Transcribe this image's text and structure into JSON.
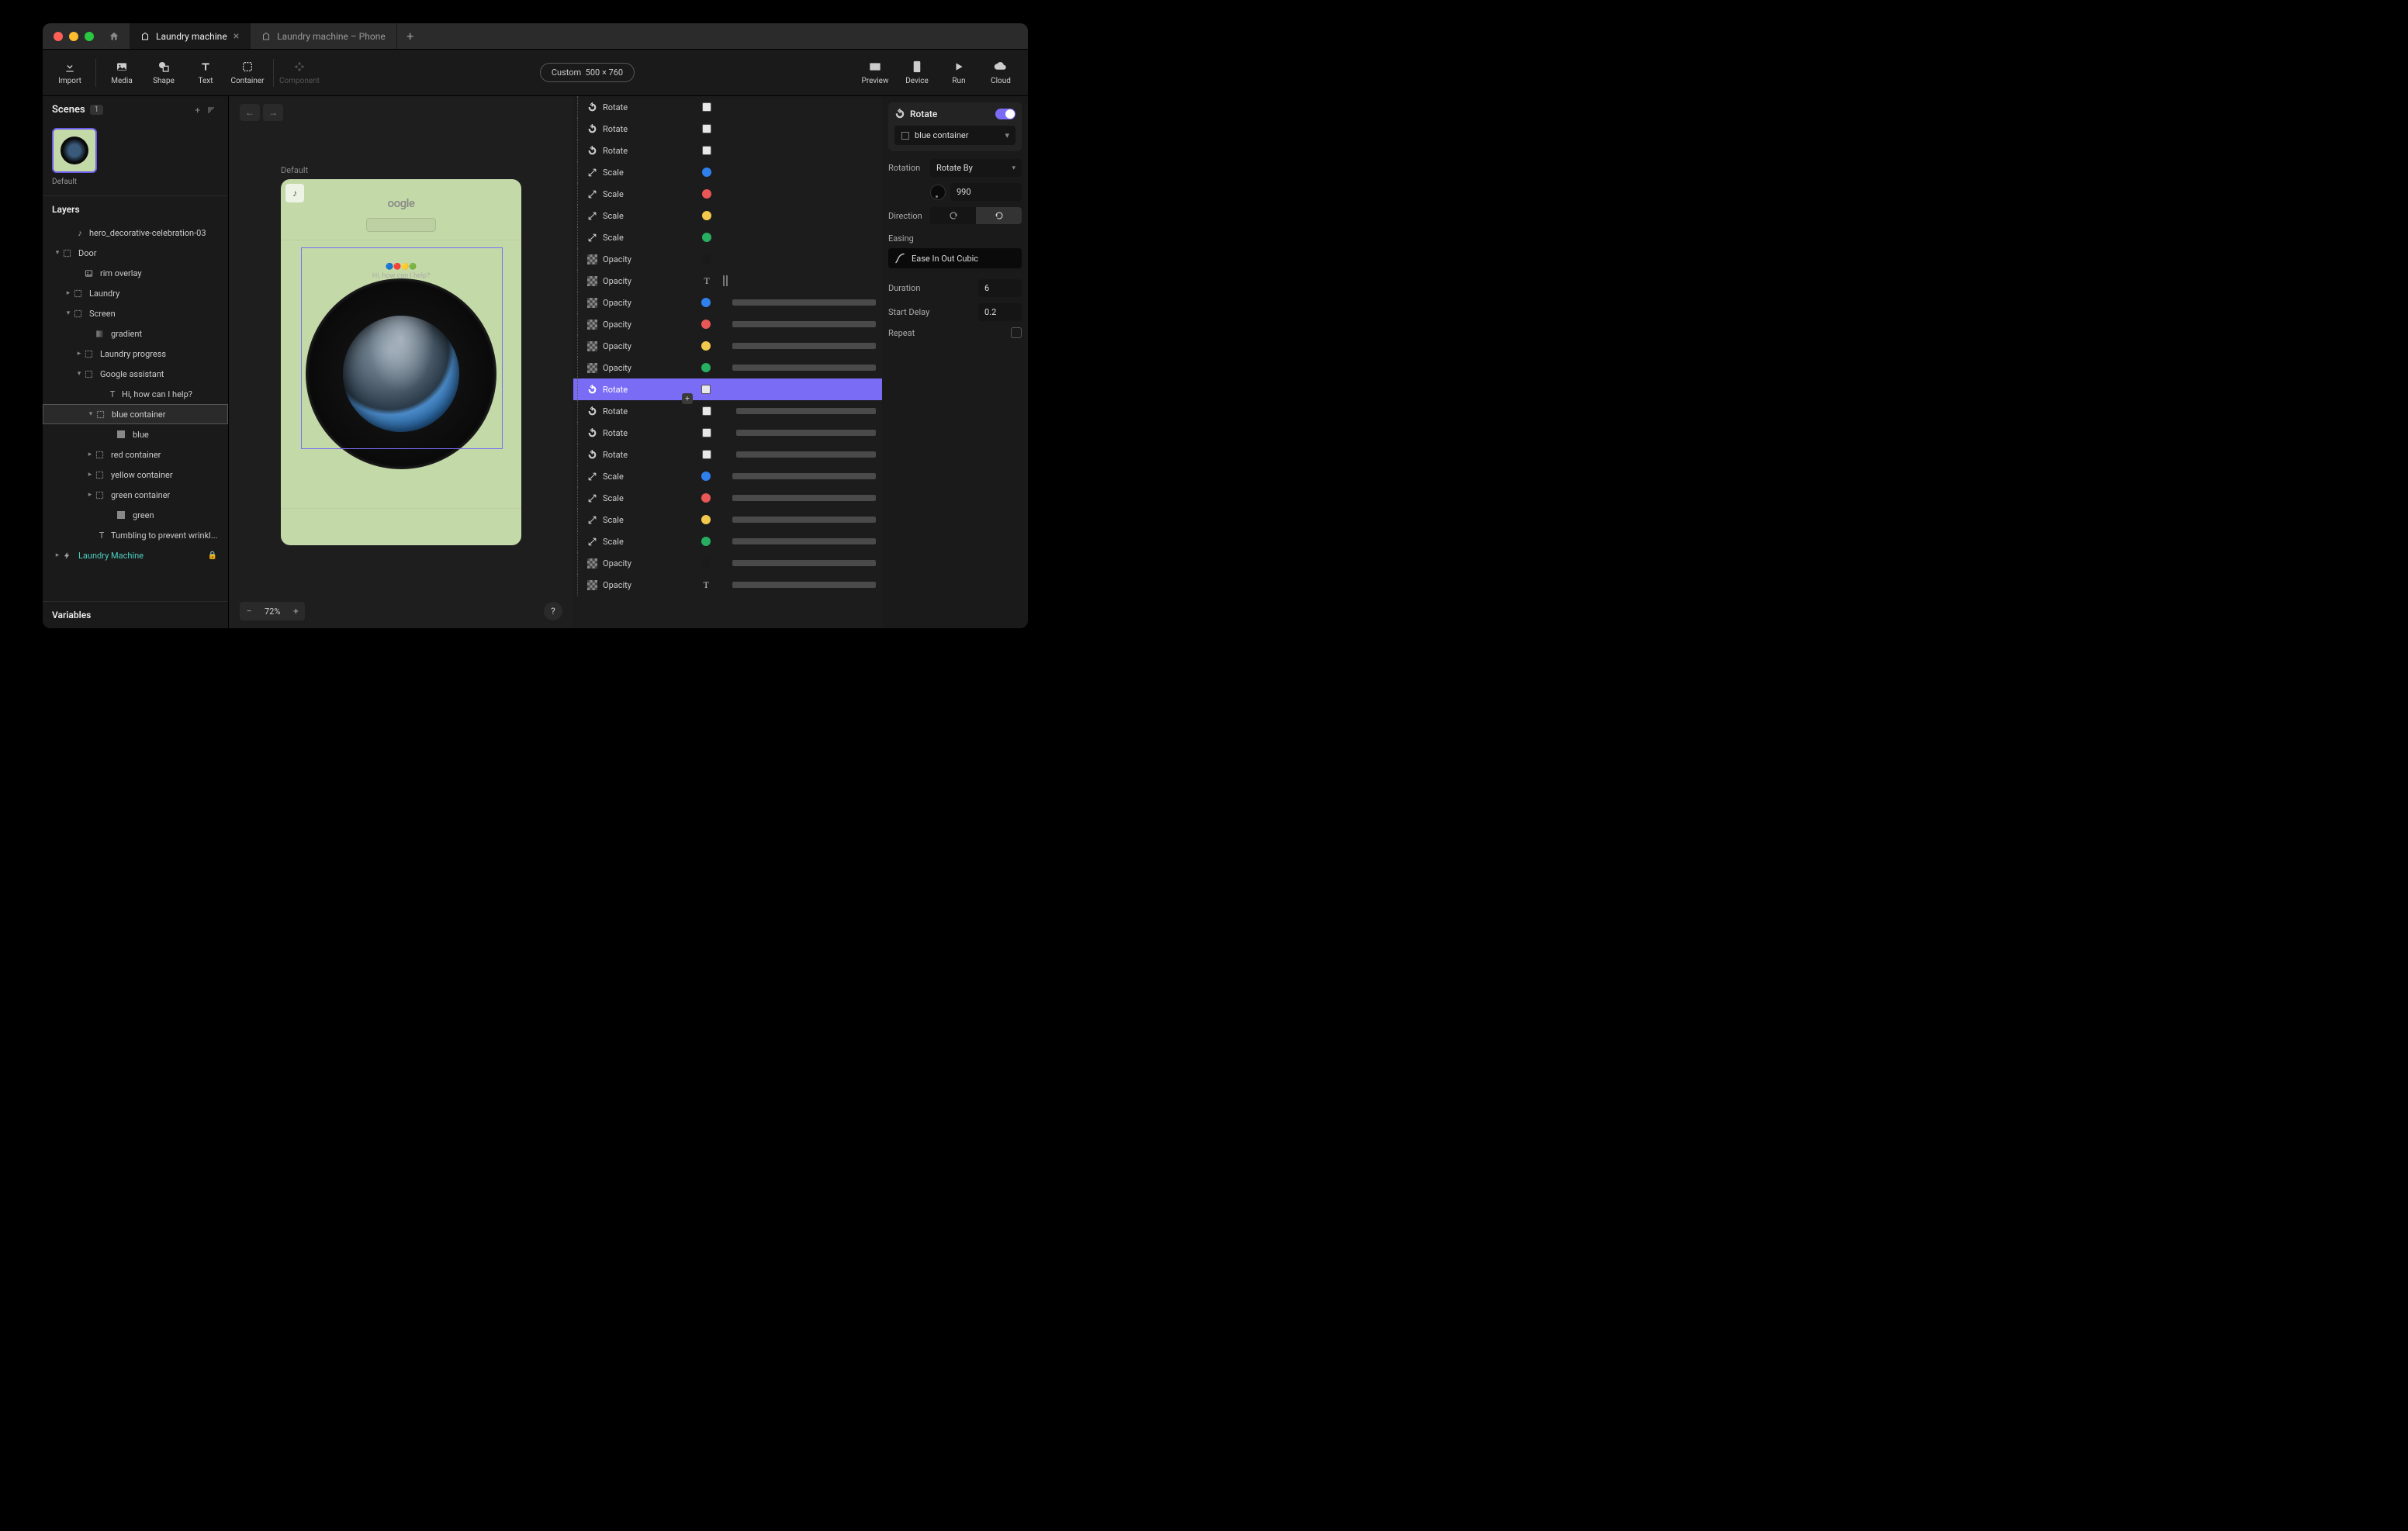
{
  "tabs": [
    {
      "title": "Laundry machine",
      "active": true
    },
    {
      "title": "Laundry machine – Phone",
      "active": false
    }
  ],
  "toolbar": {
    "import": "Import",
    "media": "Media",
    "shape": "Shape",
    "text": "Text",
    "container": "Container",
    "component": "Component",
    "canvas_size_label": "Custom",
    "canvas_size_value": "500 × 760",
    "preview": "Preview",
    "device": "Device",
    "run": "Run",
    "cloud": "Cloud"
  },
  "scenes": {
    "title": "Scenes",
    "count": "1",
    "items": [
      {
        "name": "Default"
      }
    ]
  },
  "layers": {
    "title": "Layers",
    "items": [
      {
        "indent": 1,
        "chevron": "",
        "icon": "music",
        "name": "hero_decorative-celebration-03"
      },
      {
        "indent": 0,
        "chevron": "down",
        "icon": "container",
        "name": "Door"
      },
      {
        "indent": 2,
        "chevron": "",
        "icon": "image",
        "name": "rim overlay"
      },
      {
        "indent": 1,
        "chevron": "right",
        "icon": "container",
        "name": "Laundry"
      },
      {
        "indent": 1,
        "chevron": "down",
        "icon": "container",
        "name": "Screen"
      },
      {
        "indent": 3,
        "chevron": "",
        "icon": "gradient",
        "name": "gradient"
      },
      {
        "indent": 2,
        "chevron": "right",
        "icon": "container",
        "name": "Laundry progress"
      },
      {
        "indent": 2,
        "chevron": "down",
        "icon": "container",
        "name": "Google assistant"
      },
      {
        "indent": 4,
        "chevron": "",
        "icon": "text",
        "name": "Hi, how can I help?"
      },
      {
        "indent": 3,
        "chevron": "down",
        "icon": "container",
        "name": "blue container",
        "selected": true
      },
      {
        "indent": 5,
        "chevron": "",
        "icon": "rect",
        "name": "blue"
      },
      {
        "indent": 3,
        "chevron": "right",
        "icon": "container",
        "name": "red container"
      },
      {
        "indent": 3,
        "chevron": "right",
        "icon": "container",
        "name": "yellow container"
      },
      {
        "indent": 3,
        "chevron": "right",
        "icon": "container",
        "name": "green container"
      },
      {
        "indent": 5,
        "chevron": "",
        "icon": "rect",
        "name": "green"
      },
      {
        "indent": 3,
        "chevron": "",
        "icon": "text",
        "name": "Tumbling to prevent wrinkl..."
      },
      {
        "indent": 0,
        "chevron": "right",
        "icon": "bolt",
        "name": "Laundry Machine",
        "component": true,
        "locked": true
      }
    ]
  },
  "variables_title": "Variables",
  "canvas": {
    "artboard_label": "Default",
    "brand": "oogle",
    "assistant_text": "Hi, how can I help?",
    "zoom": "72%"
  },
  "timeline": [
    {
      "type": "Rotate",
      "icon": "rotate",
      "target": "white",
      "bar": "none"
    },
    {
      "type": "Rotate",
      "icon": "rotate",
      "target": "white",
      "bar": "none"
    },
    {
      "type": "Rotate",
      "icon": "rotate",
      "target": "white",
      "bar": "none"
    },
    {
      "type": "Scale",
      "icon": "scale",
      "target": "blue",
      "shape": "circle",
      "bar": "none"
    },
    {
      "type": "Scale",
      "icon": "scale",
      "target": "red",
      "shape": "circle",
      "bar": "none"
    },
    {
      "type": "Scale",
      "icon": "scale",
      "target": "yellow",
      "shape": "circle",
      "bar": "none"
    },
    {
      "type": "Scale",
      "icon": "scale",
      "target": "green",
      "shape": "circle",
      "bar": "none"
    },
    {
      "type": "Opacity",
      "icon": "opacity",
      "target": "black",
      "shape": "circle",
      "bar": "none"
    },
    {
      "type": "Opacity",
      "icon": "opacity",
      "target": "text",
      "bar": "none",
      "extra": "handle"
    },
    {
      "type": "Opacity",
      "icon": "opacity",
      "target": "blue",
      "shape": "circle",
      "bar": "wide"
    },
    {
      "type": "Opacity",
      "icon": "opacity",
      "target": "red",
      "shape": "circle",
      "bar": "wide"
    },
    {
      "type": "Opacity",
      "icon": "opacity",
      "target": "yellow",
      "shape": "circle",
      "bar": "wide"
    },
    {
      "type": "Opacity",
      "icon": "opacity",
      "target": "green",
      "shape": "circle",
      "bar": "wide"
    },
    {
      "type": "Rotate",
      "icon": "rotate",
      "target": "white",
      "bar": "selected",
      "selected": true
    },
    {
      "type": "Rotate",
      "icon": "rotate",
      "target": "white",
      "bar": "offset",
      "add_btn": true
    },
    {
      "type": "Rotate",
      "icon": "rotate",
      "target": "white",
      "bar": "offset"
    },
    {
      "type": "Rotate",
      "icon": "rotate",
      "target": "white",
      "bar": "offset"
    },
    {
      "type": "Scale",
      "icon": "scale",
      "target": "blue",
      "shape": "circle",
      "bar": "wide"
    },
    {
      "type": "Scale",
      "icon": "scale",
      "target": "red",
      "shape": "circle",
      "bar": "wide"
    },
    {
      "type": "Scale",
      "icon": "scale",
      "target": "yellow",
      "shape": "circle",
      "bar": "wide"
    },
    {
      "type": "Scale",
      "icon": "scale",
      "target": "green",
      "shape": "circle",
      "bar": "wide"
    },
    {
      "type": "Opacity",
      "icon": "opacity",
      "target": "black",
      "shape": "circle",
      "bar": "wide"
    },
    {
      "type": "Opacity",
      "icon": "opacity",
      "target": "text",
      "bar": "wide"
    }
  ],
  "inspector": {
    "title": "Rotate",
    "target": "blue container",
    "rotation_label": "Rotation",
    "rotation_mode": "Rotate By",
    "rotation_value": "990",
    "direction_label": "Direction",
    "easing_label": "Easing",
    "easing_value": "Ease In Out Cubic",
    "duration_label": "Duration",
    "duration_value": "6",
    "start_delay_label": "Start Delay",
    "start_delay_value": "0.2",
    "repeat_label": "Repeat"
  },
  "colors": {
    "white": "#e8e8e8",
    "blue": "#2f80ed",
    "red": "#eb5757",
    "yellow": "#f2c94c",
    "green": "#27ae60",
    "black": "#1a1a1a"
  }
}
